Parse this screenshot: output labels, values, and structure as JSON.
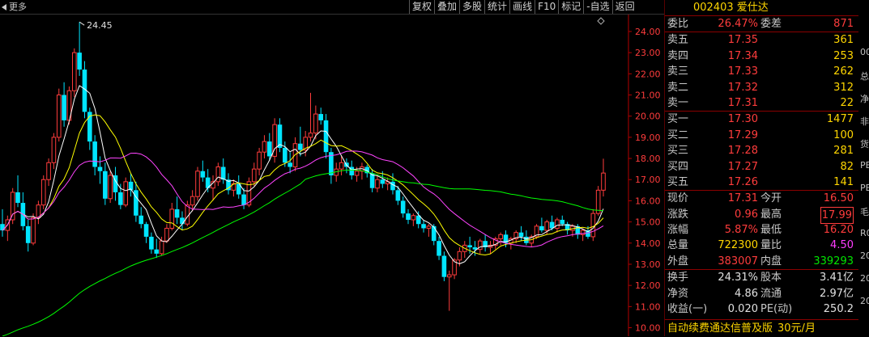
{
  "toolbar": {
    "more_label": "更多",
    "buttons": [
      "复权",
      "叠加",
      "多股",
      "统计",
      "画线",
      "F10",
      "标记",
      "-自选",
      "返回"
    ]
  },
  "chart_data": {
    "type": "candlestick",
    "ylim": [
      9.6,
      24.8
    ],
    "yticks": [
      "24.00",
      "23.00",
      "22.00",
      "21.00",
      "20.00",
      "19.00",
      "18.00",
      "17.00",
      "16.00",
      "15.00",
      "14.00",
      "13.00",
      "12.00",
      "11.00",
      "10.00"
    ],
    "peak_label": "24.45",
    "ohlc": [
      [
        14.9,
        15.6,
        14.3,
        14.6
      ],
      [
        14.6,
        15.3,
        14.1,
        15.1
      ],
      [
        15.1,
        16.6,
        14.9,
        16.4
      ],
      [
        16.4,
        17.2,
        15.7,
        15.9
      ],
      [
        15.9,
        16.4,
        14.6,
        14.8
      ],
      [
        14.8,
        15.1,
        13.6,
        14.0
      ],
      [
        14.0,
        15.4,
        13.9,
        15.2
      ],
      [
        15.2,
        16.0,
        14.9,
        15.8
      ],
      [
        15.8,
        17.2,
        15.6,
        17.0
      ],
      [
        17.0,
        18.0,
        16.7,
        17.8
      ],
      [
        17.8,
        19.2,
        17.5,
        19.0
      ],
      [
        19.0,
        21.3,
        18.8,
        21.0
      ],
      [
        21.0,
        21.6,
        19.5,
        19.8
      ],
      [
        19.8,
        21.4,
        19.6,
        21.2
      ],
      [
        21.2,
        23.2,
        20.9,
        23.0
      ],
      [
        23.0,
        24.45,
        21.9,
        22.2
      ],
      [
        22.2,
        22.6,
        19.9,
        20.2
      ],
      [
        20.2,
        20.4,
        18.4,
        18.8
      ],
      [
        18.8,
        19.1,
        17.2,
        17.6
      ],
      [
        17.6,
        18.1,
        16.8,
        17.4
      ],
      [
        17.4,
        17.8,
        15.8,
        16.1
      ],
      [
        16.1,
        17.4,
        15.9,
        17.2
      ],
      [
        17.2,
        17.6,
        16.0,
        16.4
      ],
      [
        16.4,
        16.8,
        15.6,
        15.8
      ],
      [
        15.8,
        17.1,
        15.7,
        16.9
      ],
      [
        16.9,
        17.3,
        16.2,
        16.5
      ],
      [
        16.5,
        16.9,
        15.0,
        15.3
      ],
      [
        15.3,
        15.7,
        14.7,
        14.9
      ],
      [
        14.9,
        15.0,
        14.0,
        14.3
      ],
      [
        14.3,
        14.5,
        13.5,
        13.7
      ],
      [
        13.7,
        14.2,
        13.3,
        13.5
      ],
      [
        13.5,
        14.3,
        13.4,
        14.1
      ],
      [
        14.1,
        14.9,
        14.0,
        14.7
      ],
      [
        14.7,
        15.9,
        14.6,
        15.6
      ],
      [
        15.6,
        16.2,
        14.9,
        15.2
      ],
      [
        15.2,
        15.5,
        14.6,
        14.9
      ],
      [
        14.9,
        16.0,
        14.8,
        15.8
      ],
      [
        15.8,
        16.5,
        15.5,
        16.2
      ],
      [
        16.2,
        17.6,
        16.0,
        17.4
      ],
      [
        17.4,
        17.9,
        16.9,
        17.1
      ],
      [
        17.1,
        17.5,
        16.4,
        16.6
      ],
      [
        16.6,
        17.2,
        16.0,
        16.9
      ],
      [
        16.9,
        17.8,
        16.7,
        17.6
      ],
      [
        17.6,
        18.0,
        16.8,
        17.0
      ],
      [
        17.0,
        17.3,
        16.3,
        16.5
      ],
      [
        16.5,
        17.0,
        16.2,
        16.8
      ],
      [
        16.8,
        17.2,
        16.1,
        16.3
      ],
      [
        16.3,
        16.6,
        15.6,
        15.8
      ],
      [
        15.8,
        17.1,
        15.7,
        16.9
      ],
      [
        16.9,
        17.8,
        16.7,
        17.5
      ],
      [
        17.5,
        18.5,
        17.2,
        18.3
      ],
      [
        18.3,
        19.1,
        18.0,
        18.8
      ],
      [
        18.8,
        19.2,
        17.9,
        18.1
      ],
      [
        18.1,
        19.9,
        17.8,
        19.6
      ],
      [
        19.6,
        19.9,
        18.3,
        18.5
      ],
      [
        18.5,
        18.8,
        17.6,
        17.8
      ],
      [
        17.8,
        18.3,
        17.3,
        17.6
      ],
      [
        17.6,
        19.0,
        17.4,
        18.7
      ],
      [
        18.7,
        19.5,
        18.1,
        18.4
      ],
      [
        18.4,
        19.3,
        18.1,
        19.0
      ],
      [
        19.0,
        21.1,
        18.8,
        19.2
      ],
      [
        19.2,
        20.5,
        18.9,
        20.1
      ],
      [
        20.1,
        20.4,
        19.6,
        19.8
      ],
      [
        19.8,
        20.1,
        18.0,
        18.3
      ],
      [
        18.3,
        18.5,
        16.8,
        17.2
      ],
      [
        17.2,
        17.8,
        16.9,
        17.5
      ],
      [
        17.5,
        18.1,
        17.2,
        17.8
      ],
      [
        17.8,
        18.0,
        17.3,
        17.6
      ],
      [
        17.6,
        17.9,
        17.0,
        17.2
      ],
      [
        17.2,
        17.6,
        16.9,
        17.4
      ],
      [
        17.4,
        17.8,
        17.0,
        17.6
      ],
      [
        17.6,
        17.7,
        17.1,
        17.3
      ],
      [
        17.3,
        17.5,
        16.4,
        16.6
      ],
      [
        16.6,
        17.2,
        16.4,
        17.0
      ],
      [
        17.0,
        17.4,
        16.6,
        16.8
      ],
      [
        16.8,
        17.1,
        16.5,
        16.9
      ],
      [
        16.9,
        17.3,
        16.3,
        16.5
      ],
      [
        16.5,
        16.7,
        15.8,
        16.0
      ],
      [
        16.0,
        16.2,
        15.2,
        15.4
      ],
      [
        15.4,
        15.6,
        14.9,
        15.1
      ],
      [
        15.1,
        15.4,
        14.8,
        15.3
      ],
      [
        15.3,
        15.5,
        14.7,
        14.9
      ],
      [
        14.9,
        15.1,
        14.5,
        14.7
      ],
      [
        14.7,
        14.9,
        14.3,
        14.8
      ],
      [
        14.8,
        14.9,
        13.9,
        14.1
      ],
      [
        14.1,
        14.3,
        13.2,
        13.4
      ],
      [
        13.4,
        13.6,
        12.2,
        12.4
      ],
      [
        12.4,
        12.7,
        10.8,
        12.5
      ],
      [
        12.5,
        13.3,
        12.3,
        13.2
      ],
      [
        13.2,
        13.8,
        12.9,
        13.6
      ],
      [
        13.6,
        14.1,
        13.3,
        13.9
      ],
      [
        13.9,
        14.3,
        13.5,
        13.8
      ],
      [
        13.8,
        14.1,
        13.4,
        13.7
      ],
      [
        13.7,
        14.2,
        13.5,
        14.1
      ],
      [
        14.1,
        14.4,
        13.6,
        13.8
      ],
      [
        13.8,
        14.1,
        13.5,
        13.9
      ],
      [
        13.9,
        14.3,
        13.7,
        14.2
      ],
      [
        14.2,
        14.5,
        13.9,
        14.4
      ],
      [
        14.4,
        14.6,
        13.8,
        14.0
      ],
      [
        14.0,
        14.3,
        13.7,
        14.2
      ],
      [
        14.2,
        14.6,
        14.0,
        14.5
      ],
      [
        14.5,
        14.8,
        14.1,
        14.3
      ],
      [
        14.3,
        14.6,
        13.9,
        14.0
      ],
      [
        14.0,
        14.4,
        13.8,
        14.3
      ],
      [
        14.3,
        14.9,
        14.2,
        14.8
      ],
      [
        14.8,
        15.2,
        14.5,
        14.6
      ],
      [
        14.6,
        15.1,
        14.4,
        15.0
      ],
      [
        15.0,
        15.3,
        14.6,
        14.7
      ],
      [
        14.7,
        15.2,
        14.5,
        15.1
      ],
      [
        15.1,
        15.3,
        14.8,
        14.9
      ],
      [
        14.9,
        15.0,
        14.4,
        14.6
      ],
      [
        14.6,
        14.9,
        14.3,
        14.8
      ],
      [
        14.8,
        14.9,
        14.2,
        14.4
      ],
      [
        14.4,
        14.7,
        14.1,
        14.6
      ],
      [
        14.6,
        14.8,
        14.2,
        14.3
      ],
      [
        14.3,
        15.6,
        14.1,
        15.4
      ],
      [
        15.4,
        16.7,
        15.3,
        16.5
      ],
      [
        16.5,
        17.99,
        16.2,
        17.31
      ]
    ]
  },
  "quote": {
    "code": "002403",
    "name": "爱仕达",
    "weibi_label": "委比",
    "weibi": "26.47%",
    "weicha_label": "委差",
    "weicha": "871",
    "asks": [
      {
        "label": "卖五",
        "price": "17.35",
        "vol": "361"
      },
      {
        "label": "卖四",
        "price": "17.34",
        "vol": "253"
      },
      {
        "label": "卖三",
        "price": "17.33",
        "vol": "262"
      },
      {
        "label": "卖二",
        "price": "17.32",
        "vol": "312"
      },
      {
        "label": "卖一",
        "price": "17.31",
        "vol": "22"
      }
    ],
    "bids": [
      {
        "label": "买一",
        "price": "17.30",
        "vol": "1477"
      },
      {
        "label": "买二",
        "price": "17.29",
        "vol": "100"
      },
      {
        "label": "买三",
        "price": "17.28",
        "vol": "281"
      },
      {
        "label": "买四",
        "price": "17.27",
        "vol": "82"
      },
      {
        "label": "买五",
        "price": "17.26",
        "vol": "141"
      }
    ],
    "stats": [
      {
        "l1": "现价",
        "v1": "17.31",
        "c1": "red",
        "l2": "今开",
        "v2": "16.50",
        "c2": "red"
      },
      {
        "l1": "涨跌",
        "v1": "0.96",
        "c1": "red",
        "l2": "最高",
        "v2": "17.99",
        "c2": "red",
        "box2": true
      },
      {
        "l1": "涨幅",
        "v1": "5.87%",
        "c1": "red",
        "l2": "最低",
        "v2": "16.20",
        "c2": "red"
      },
      {
        "l1": "总量",
        "v1": "722300",
        "c1": "yel",
        "l2": "量比",
        "v2": "4.50",
        "c2": "mag"
      },
      {
        "l1": "外盘",
        "v1": "383007",
        "c1": "red",
        "l2": "内盘",
        "v2": "339293",
        "c2": "grn"
      }
    ],
    "fund": [
      {
        "l1": "换手",
        "v1": "24.31%",
        "l2": "股本",
        "v2": "3.41亿"
      },
      {
        "l1": "净资",
        "v1": "4.86",
        "l2": "流通",
        "v2": "2.97亿"
      },
      {
        "l1": "收益(一)",
        "v1": "0.020",
        "l2": "PE(动)",
        "v2": "250.2"
      }
    ],
    "banner_text": "自动续费通达信普及版",
    "banner_price": "30元/月"
  },
  "edge_chars": [
    "00",
    "总",
    "净",
    "非",
    "货",
    "PE",
    "PE",
    "毛",
    "R0",
    "20",
    "20",
    "20"
  ],
  "colors": {
    "up": "#ff3c3c",
    "down": "#00e5ff",
    "ma5": "#ffffff",
    "ma10": "#ffff00",
    "ma20": "#ff44ff",
    "ma60": "#00ff00",
    "axis": "#b40000"
  }
}
